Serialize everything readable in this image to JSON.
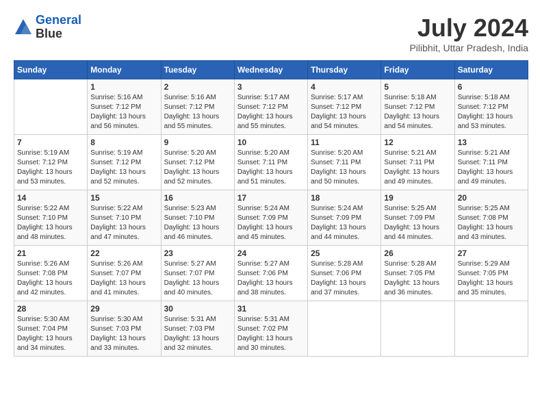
{
  "logo": {
    "line1": "General",
    "line2": "Blue"
  },
  "title": {
    "month_year": "July 2024",
    "location": "Pilibhit, Uttar Pradesh, India"
  },
  "days_of_week": [
    "Sunday",
    "Monday",
    "Tuesday",
    "Wednesday",
    "Thursday",
    "Friday",
    "Saturday"
  ],
  "weeks": [
    [
      {
        "day": "",
        "info": ""
      },
      {
        "day": "1",
        "info": "Sunrise: 5:16 AM\nSunset: 7:12 PM\nDaylight: 13 hours\nand 56 minutes."
      },
      {
        "day": "2",
        "info": "Sunrise: 5:16 AM\nSunset: 7:12 PM\nDaylight: 13 hours\nand 55 minutes."
      },
      {
        "day": "3",
        "info": "Sunrise: 5:17 AM\nSunset: 7:12 PM\nDaylight: 13 hours\nand 55 minutes."
      },
      {
        "day": "4",
        "info": "Sunrise: 5:17 AM\nSunset: 7:12 PM\nDaylight: 13 hours\nand 54 minutes."
      },
      {
        "day": "5",
        "info": "Sunrise: 5:18 AM\nSunset: 7:12 PM\nDaylight: 13 hours\nand 54 minutes."
      },
      {
        "day": "6",
        "info": "Sunrise: 5:18 AM\nSunset: 7:12 PM\nDaylight: 13 hours\nand 53 minutes."
      }
    ],
    [
      {
        "day": "7",
        "info": "Sunrise: 5:19 AM\nSunset: 7:12 PM\nDaylight: 13 hours\nand 53 minutes."
      },
      {
        "day": "8",
        "info": "Sunrise: 5:19 AM\nSunset: 7:12 PM\nDaylight: 13 hours\nand 52 minutes."
      },
      {
        "day": "9",
        "info": "Sunrise: 5:20 AM\nSunset: 7:12 PM\nDaylight: 13 hours\nand 52 minutes."
      },
      {
        "day": "10",
        "info": "Sunrise: 5:20 AM\nSunset: 7:11 PM\nDaylight: 13 hours\nand 51 minutes."
      },
      {
        "day": "11",
        "info": "Sunrise: 5:20 AM\nSunset: 7:11 PM\nDaylight: 13 hours\nand 50 minutes."
      },
      {
        "day": "12",
        "info": "Sunrise: 5:21 AM\nSunset: 7:11 PM\nDaylight: 13 hours\nand 49 minutes."
      },
      {
        "day": "13",
        "info": "Sunrise: 5:21 AM\nSunset: 7:11 PM\nDaylight: 13 hours\nand 49 minutes."
      }
    ],
    [
      {
        "day": "14",
        "info": "Sunrise: 5:22 AM\nSunset: 7:10 PM\nDaylight: 13 hours\nand 48 minutes."
      },
      {
        "day": "15",
        "info": "Sunrise: 5:22 AM\nSunset: 7:10 PM\nDaylight: 13 hours\nand 47 minutes."
      },
      {
        "day": "16",
        "info": "Sunrise: 5:23 AM\nSunset: 7:10 PM\nDaylight: 13 hours\nand 46 minutes."
      },
      {
        "day": "17",
        "info": "Sunrise: 5:24 AM\nSunset: 7:09 PM\nDaylight: 13 hours\nand 45 minutes."
      },
      {
        "day": "18",
        "info": "Sunrise: 5:24 AM\nSunset: 7:09 PM\nDaylight: 13 hours\nand 44 minutes."
      },
      {
        "day": "19",
        "info": "Sunrise: 5:25 AM\nSunset: 7:09 PM\nDaylight: 13 hours\nand 44 minutes."
      },
      {
        "day": "20",
        "info": "Sunrise: 5:25 AM\nSunset: 7:08 PM\nDaylight: 13 hours\nand 43 minutes."
      }
    ],
    [
      {
        "day": "21",
        "info": "Sunrise: 5:26 AM\nSunset: 7:08 PM\nDaylight: 13 hours\nand 42 minutes."
      },
      {
        "day": "22",
        "info": "Sunrise: 5:26 AM\nSunset: 7:07 PM\nDaylight: 13 hours\nand 41 minutes."
      },
      {
        "day": "23",
        "info": "Sunrise: 5:27 AM\nSunset: 7:07 PM\nDaylight: 13 hours\nand 40 minutes."
      },
      {
        "day": "24",
        "info": "Sunrise: 5:27 AM\nSunset: 7:06 PM\nDaylight: 13 hours\nand 38 minutes."
      },
      {
        "day": "25",
        "info": "Sunrise: 5:28 AM\nSunset: 7:06 PM\nDaylight: 13 hours\nand 37 minutes."
      },
      {
        "day": "26",
        "info": "Sunrise: 5:28 AM\nSunset: 7:05 PM\nDaylight: 13 hours\nand 36 minutes."
      },
      {
        "day": "27",
        "info": "Sunrise: 5:29 AM\nSunset: 7:05 PM\nDaylight: 13 hours\nand 35 minutes."
      }
    ],
    [
      {
        "day": "28",
        "info": "Sunrise: 5:30 AM\nSunset: 7:04 PM\nDaylight: 13 hours\nand 34 minutes."
      },
      {
        "day": "29",
        "info": "Sunrise: 5:30 AM\nSunset: 7:03 PM\nDaylight: 13 hours\nand 33 minutes."
      },
      {
        "day": "30",
        "info": "Sunrise: 5:31 AM\nSunset: 7:03 PM\nDaylight: 13 hours\nand 32 minutes."
      },
      {
        "day": "31",
        "info": "Sunrise: 5:31 AM\nSunset: 7:02 PM\nDaylight: 13 hours\nand 30 minutes."
      },
      {
        "day": "",
        "info": ""
      },
      {
        "day": "",
        "info": ""
      },
      {
        "day": "",
        "info": ""
      }
    ]
  ]
}
